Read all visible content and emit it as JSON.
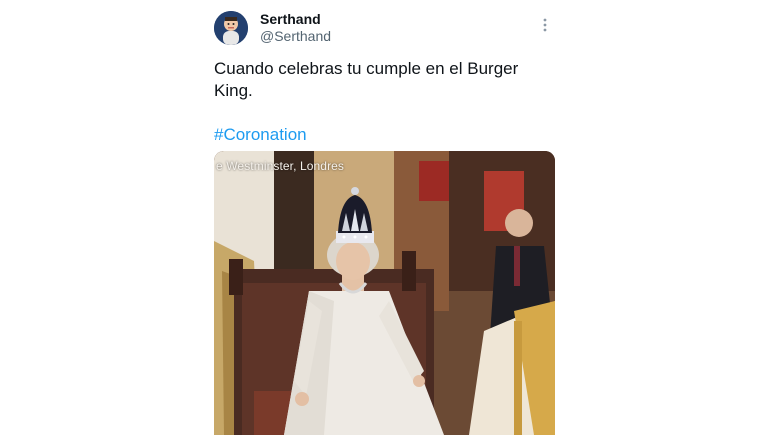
{
  "tweet": {
    "author": {
      "display_name": "Serthand",
      "handle": "@Serthand"
    },
    "text": "Cuando celebras tu cumple en el Burger King.",
    "hashtag": "#Coronation",
    "more_icon": "more-dots-vertical-icon"
  },
  "media": {
    "caption": "e Westminster, Londres"
  },
  "colors": {
    "link": "#1d9bf0",
    "text": "#0f1419",
    "muted": "#536471"
  }
}
